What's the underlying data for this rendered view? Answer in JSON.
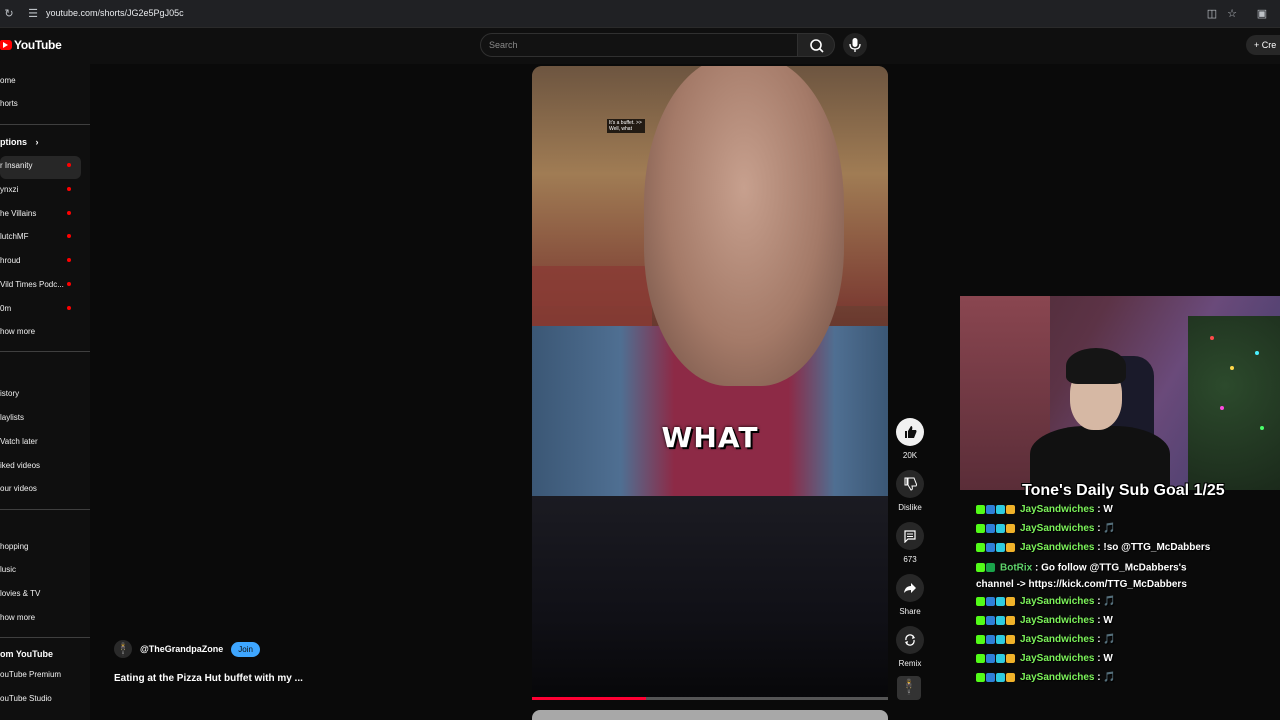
{
  "browser": {
    "url": "youtube.com/shorts/JG2e5PgJ05c"
  },
  "header": {
    "logo_text": "YouTube",
    "search_placeholder": "Search",
    "create_label": "Cre"
  },
  "sidebar": {
    "main": [
      {
        "label": "ome"
      },
      {
        "label": "horts"
      }
    ],
    "subscriptions_title": "ptions",
    "subscriptions": [
      {
        "label": "r Insanity"
      },
      {
        "label": "ynxzi"
      },
      {
        "label": "he Villains"
      },
      {
        "label": "lutchMF"
      },
      {
        "label": "hroud"
      },
      {
        "label": "Vild Times Podc..."
      },
      {
        "label": "0m"
      }
    ],
    "show_more_1": "how more",
    "you": [
      {
        "label": "istory"
      },
      {
        "label": "laylists"
      },
      {
        "label": "Vatch later"
      },
      {
        "label": "iked videos"
      },
      {
        "label": "our videos"
      }
    ],
    "explore": [
      {
        "label": "hopping"
      },
      {
        "label": "lusic"
      },
      {
        "label": "lovies & TV"
      }
    ],
    "show_more_2": "how more",
    "more_title": "om YouTube",
    "more": [
      {
        "label": "ouTube Premium"
      },
      {
        "label": "ouTube Studio"
      }
    ]
  },
  "video": {
    "caption": "WHAT",
    "subtitle_overlay": "It's a buffet. >> Well, what",
    "progress": 0.32,
    "channel_name": "@TheGrandpaZone",
    "join_label": "Join",
    "title": "Eating at the Pizza Hut buffet with my ..."
  },
  "actions": {
    "like_count": "20K",
    "dislike_label": "Dislike",
    "comments_count": "673",
    "share_label": "Share",
    "remix_label": "Remix"
  },
  "stream_overlay": {
    "sub_goal": "Tone's Daily Sub Goal 1/25",
    "chat": [
      {
        "user": "JaySandwiches",
        "text": "W"
      },
      {
        "user": "JaySandwiches",
        "text": "🎵"
      },
      {
        "user": "JaySandwiches",
        "text": "!so @TTG_McDabbers"
      },
      {
        "user": "BotRix",
        "text": "Go follow @TTG_McDabbers's channel -> https://kick.com/TTG_McDabbers"
      },
      {
        "user": "JaySandwiches",
        "text": "🎵"
      },
      {
        "user": "JaySandwiches",
        "text": "W"
      },
      {
        "user": "JaySandwiches",
        "text": "🎵"
      },
      {
        "user": "JaySandwiches",
        "text": "W"
      },
      {
        "user": "JaySandwiches",
        "text": "🎵"
      }
    ]
  },
  "colors": {
    "accent_red": "#ff0000",
    "join_blue": "#3ea6ff",
    "chat_user_green": "#7cf25a"
  }
}
